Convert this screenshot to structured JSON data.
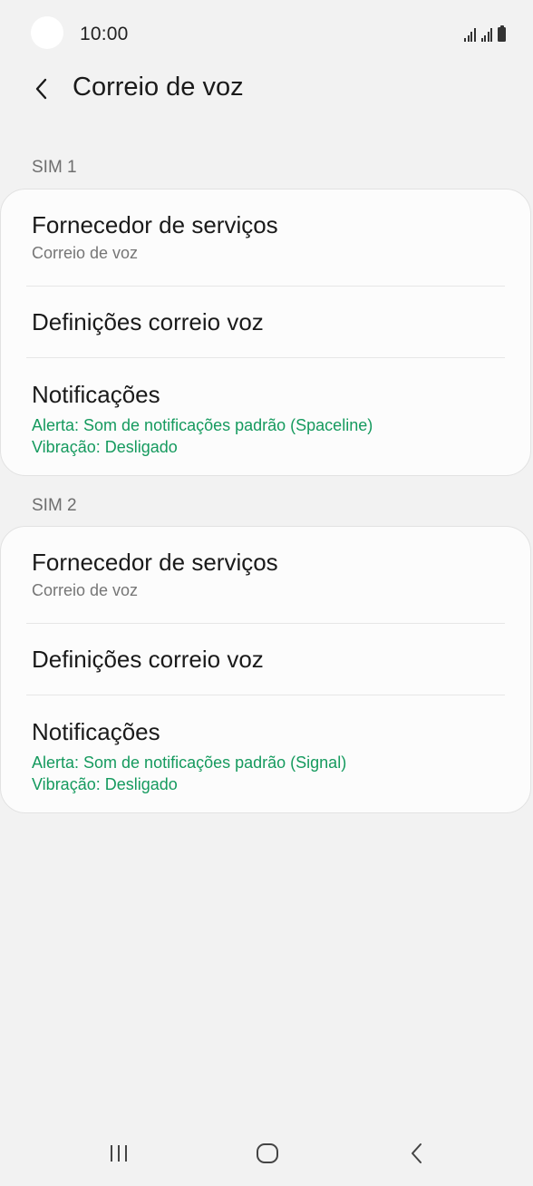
{
  "status_bar": {
    "time": "10:00"
  },
  "header": {
    "title": "Correio de voz",
    "back_icon": "chevron-left-icon"
  },
  "sections": [
    {
      "label": "SIM 1",
      "items": [
        {
          "title": "Fornecedor de serviços",
          "subtitle": "Correio de voz"
        },
        {
          "title": "Definições correio voz"
        },
        {
          "title": "Notificações",
          "alert": "Alerta: Som de notificações padrão (Spaceline)",
          "vibration": "Vibração: Desligado"
        }
      ]
    },
    {
      "label": "SIM 2",
      "items": [
        {
          "title": "Fornecedor de serviços",
          "subtitle": "Correio de voz"
        },
        {
          "title": "Definições correio voz"
        },
        {
          "title": "Notificações",
          "alert": "Alerta: Som de notificações padrão (Signal)",
          "vibration": "Vibração: Desligado"
        }
      ]
    }
  ],
  "nav_bar": {
    "recents_icon": "recents-icon",
    "home_icon": "home-icon",
    "back_icon": "back-icon"
  },
  "colors": {
    "background": "#f2f2f2",
    "card": "#fcfcfc",
    "accent_green": "#159a5e",
    "secondary_text": "#767676"
  }
}
